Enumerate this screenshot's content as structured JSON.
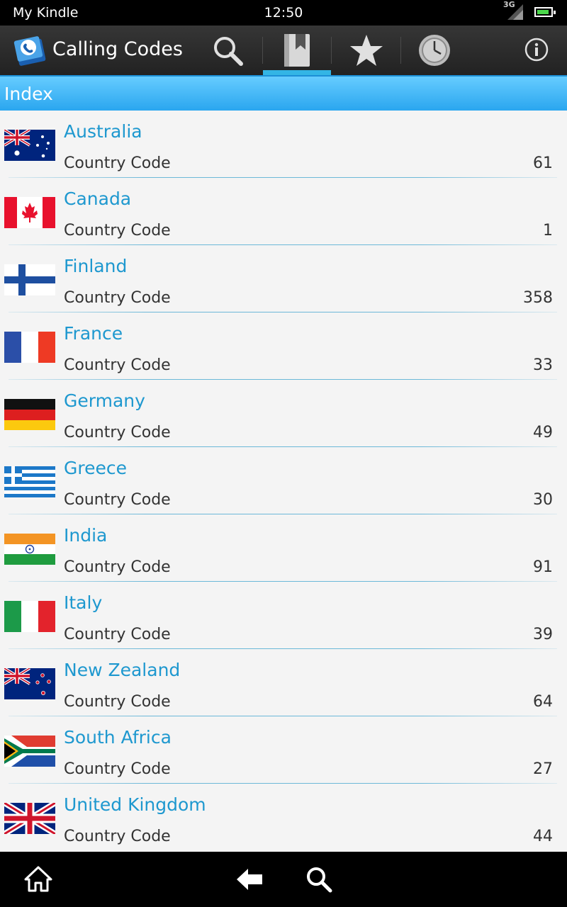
{
  "status_bar": {
    "device_name": "My Kindle",
    "time": "12:50",
    "network": "3G",
    "signal_icon": "signal-icon",
    "battery_icon": "battery-icon"
  },
  "action_bar": {
    "app_title": "Calling Codes",
    "logo_icon": "phone-book-logo-icon",
    "tabs": [
      {
        "id": "search",
        "icon": "search-icon",
        "active": false
      },
      {
        "id": "index",
        "icon": "book-icon",
        "active": true
      },
      {
        "id": "favorites",
        "icon": "star-icon",
        "active": false
      },
      {
        "id": "history",
        "icon": "clock-icon",
        "active": false
      }
    ],
    "info_icon": "info-icon",
    "accent_color": "#33b5e5"
  },
  "section": {
    "title": "Index"
  },
  "countries": [
    {
      "name": "Australia",
      "label": "Country Code",
      "code": "61"
    },
    {
      "name": "Canada",
      "label": "Country Code",
      "code": "1"
    },
    {
      "name": "Finland",
      "label": "Country Code",
      "code": "358"
    },
    {
      "name": "France",
      "label": "Country Code",
      "code": "33"
    },
    {
      "name": "Germany",
      "label": "Country Code",
      "code": "49"
    },
    {
      "name": "Greece",
      "label": "Country Code",
      "code": "30"
    },
    {
      "name": "India",
      "label": "Country Code",
      "code": "91"
    },
    {
      "name": "Italy",
      "label": "Country Code",
      "code": "39"
    },
    {
      "name": "New Zealand",
      "label": "Country Code",
      "code": "64"
    },
    {
      "name": "South Africa",
      "label": "Country Code",
      "code": "27"
    },
    {
      "name": "United Kingdom",
      "label": "Country Code",
      "code": "44"
    }
  ],
  "nav_bar": {
    "home_icon": "home-icon",
    "back_icon": "back-arrow-icon",
    "search_icon": "search-icon"
  },
  "colors": {
    "country_name": "#1e98cf",
    "header_gradient_top": "#66ccff",
    "header_gradient_bottom": "#2aa6ef"
  }
}
